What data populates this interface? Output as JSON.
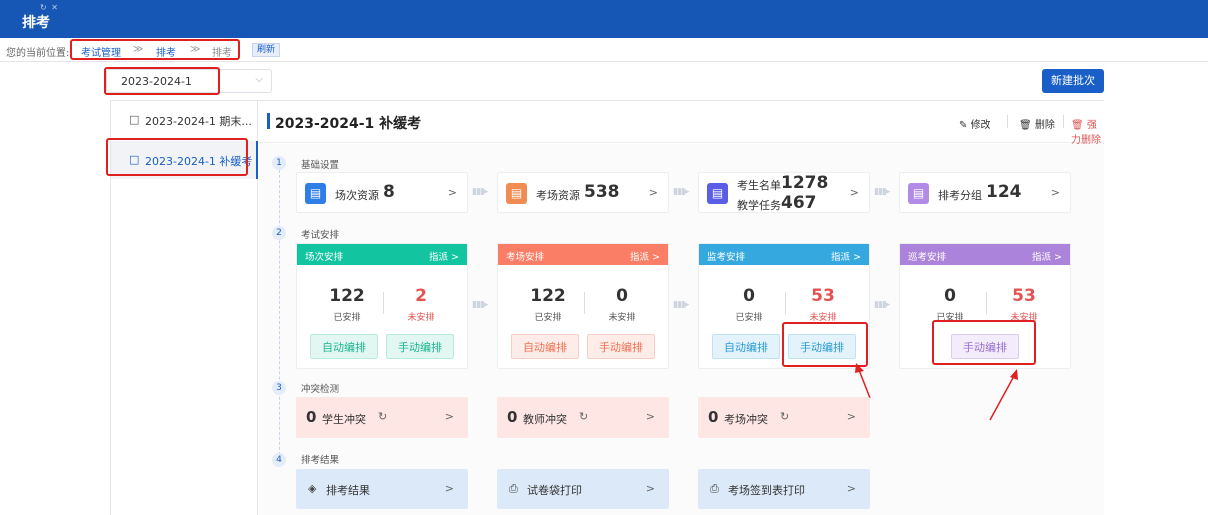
{
  "topbar": {
    "title": "排考",
    "tab_icons": "↻ ✕"
  },
  "breadcrumb": {
    "prefix": "您的当前位置:",
    "items": [
      "考试管理",
      "≫",
      "排考",
      "≫",
      "排考"
    ],
    "refresh_label": "刷新"
  },
  "batch_select": {
    "value": "2023-2024-1",
    "chevron": "⌵"
  },
  "new_batch_label": "新建批次",
  "sidebar": {
    "items": [
      {
        "icon": "bookmark-icon",
        "label": "2023-2024-1 期末..."
      },
      {
        "icon": "bookmark-icon",
        "label": "2023-2024-1 补缓考"
      }
    ]
  },
  "header": {
    "title": "2023-2024-1 补缓考",
    "edit_label": "修改",
    "delete_label": "删除",
    "force_delete_label": "强力删除"
  },
  "steps": [
    {
      "num": "1",
      "title": "基础设置"
    },
    {
      "num": "2",
      "title": "考试安排"
    },
    {
      "num": "3",
      "title": "冲突检测"
    },
    {
      "num": "4",
      "title": "排考结果"
    }
  ],
  "resources": [
    {
      "label": "场次资源",
      "value": "8",
      "color": "#2f7ee8"
    },
    {
      "label": "考场资源",
      "value": "538",
      "color": "#f08c52"
    },
    {
      "label": "考生名单",
      "value": "1278",
      "label2": "教学任务",
      "value2": "467",
      "color": "#5a5ee6"
    },
    {
      "label": "排考分组",
      "value": "124",
      "color": "#b28be6"
    }
  ],
  "arrangements": [
    {
      "title": "场次安排",
      "assign": "指派 >",
      "color": "#13c4a1",
      "done": "122",
      "done_label": "已安排",
      "todo": "2",
      "todo_label": "未安排",
      "auto": "自动编排",
      "manual": "手动编排"
    },
    {
      "title": "考场安排",
      "assign": "指派 >",
      "color": "#fa7e66",
      "done": "122",
      "done_label": "已安排",
      "todo": "0",
      "todo_label": "未安排",
      "auto": "自动编排",
      "manual": "手动编排"
    },
    {
      "title": "监考安排",
      "assign": "指派 >",
      "color": "#35a9df",
      "done": "0",
      "done_label": "已安排",
      "todo": "53",
      "todo_label": "未安排",
      "auto": "自动编排",
      "manual": "手动编排"
    },
    {
      "title": "巡考安排",
      "assign": "指派 >",
      "color": "#ab83db",
      "done": "0",
      "done_label": "已安排",
      "todo": "53",
      "todo_label": "未安排",
      "manual": "手动编排"
    }
  ],
  "conflicts": [
    {
      "count": "0",
      "label": "学生冲突"
    },
    {
      "count": "0",
      "label": "教师冲突"
    },
    {
      "count": "0",
      "label": "考场冲突"
    }
  ],
  "results": [
    {
      "icon": "layers-icon",
      "label": "排考结果"
    },
    {
      "icon": "printer-icon",
      "label": "试卷袋打印"
    },
    {
      "icon": "printer-icon",
      "label": "考场签到表打印"
    }
  ],
  "arrow_glyph": ">",
  "colors": {
    "primary": "#1a5fc8",
    "header_bg": "#1656b4",
    "danger": "#e02020"
  }
}
